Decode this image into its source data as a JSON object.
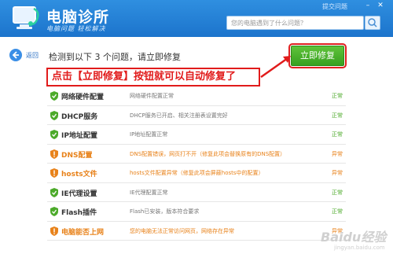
{
  "header": {
    "title": "电脑诊所",
    "subtitle": "电脑问题 轻松解决",
    "top_link": "提交问题",
    "search_placeholder": "您的电脑遇到了什么问题？"
  },
  "back_label": "返回",
  "summary": "检测到以下 3 个问题，请立即修复",
  "fix_button_label": "立即修复",
  "annotation": "点击【立即修复】按钮就可以自动修复了",
  "items": [
    {
      "name": "网络硬件配置",
      "desc": "网络硬件配置正常",
      "status": "正常",
      "state": "ok"
    },
    {
      "name": "DHCP服务",
      "desc": "DHCP服务已开启、相关注册表设置完好",
      "status": "正常",
      "state": "ok"
    },
    {
      "name": "IP地址配置",
      "desc": "IP地址配置正常",
      "status": "正常",
      "state": "ok"
    },
    {
      "name": "DNS配置",
      "desc": "DNS配置错误，网页打不开（修复此项会替换原有的DNS配置）",
      "status": "异常",
      "state": "warn"
    },
    {
      "name": "hosts文件",
      "desc": "hosts文件配置异常（修复此项会屏蔽hosts中的配置）",
      "status": "异常",
      "state": "warn"
    },
    {
      "name": "IE代理设置",
      "desc": "IE代理配置正常",
      "status": "正常",
      "state": "ok"
    },
    {
      "name": "Flash插件",
      "desc": "Flash已安装，版本符合要求",
      "status": "正常",
      "state": "ok"
    },
    {
      "name": "电脑能否上网",
      "desc": "您的电脑无法正常访问网页，网络存在异常",
      "status": "异常",
      "state": "warn"
    }
  ],
  "watermark": "Baidu经验",
  "watermark_sub": "jingyan.baidu.com",
  "colors": {
    "ok": "#4caa2a",
    "warn": "#e8821a",
    "header": "#1c74cc",
    "annotation": "#e11b1b"
  }
}
